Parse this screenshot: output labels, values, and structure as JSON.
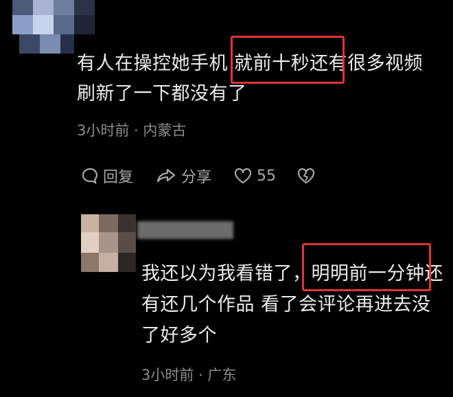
{
  "comments": [
    {
      "text_line1": "有人在操控她手机 就前十秒还有很多视频",
      "text_line2": "刷新了一下都没有了",
      "meta": "3小时前 · 内蒙古",
      "reply_label": "回复",
      "share_label": "分享",
      "likes": "55"
    },
    {
      "text_line1": "我还以为我看错了，明明前一分钟还",
      "text_line2": "有还几个作品 看了会评论再进去没",
      "text_line3": "了好多个",
      "meta": "3小时前 · 广东"
    }
  ],
  "colors": {
    "highlight": "#e23434",
    "background": "#000000"
  }
}
